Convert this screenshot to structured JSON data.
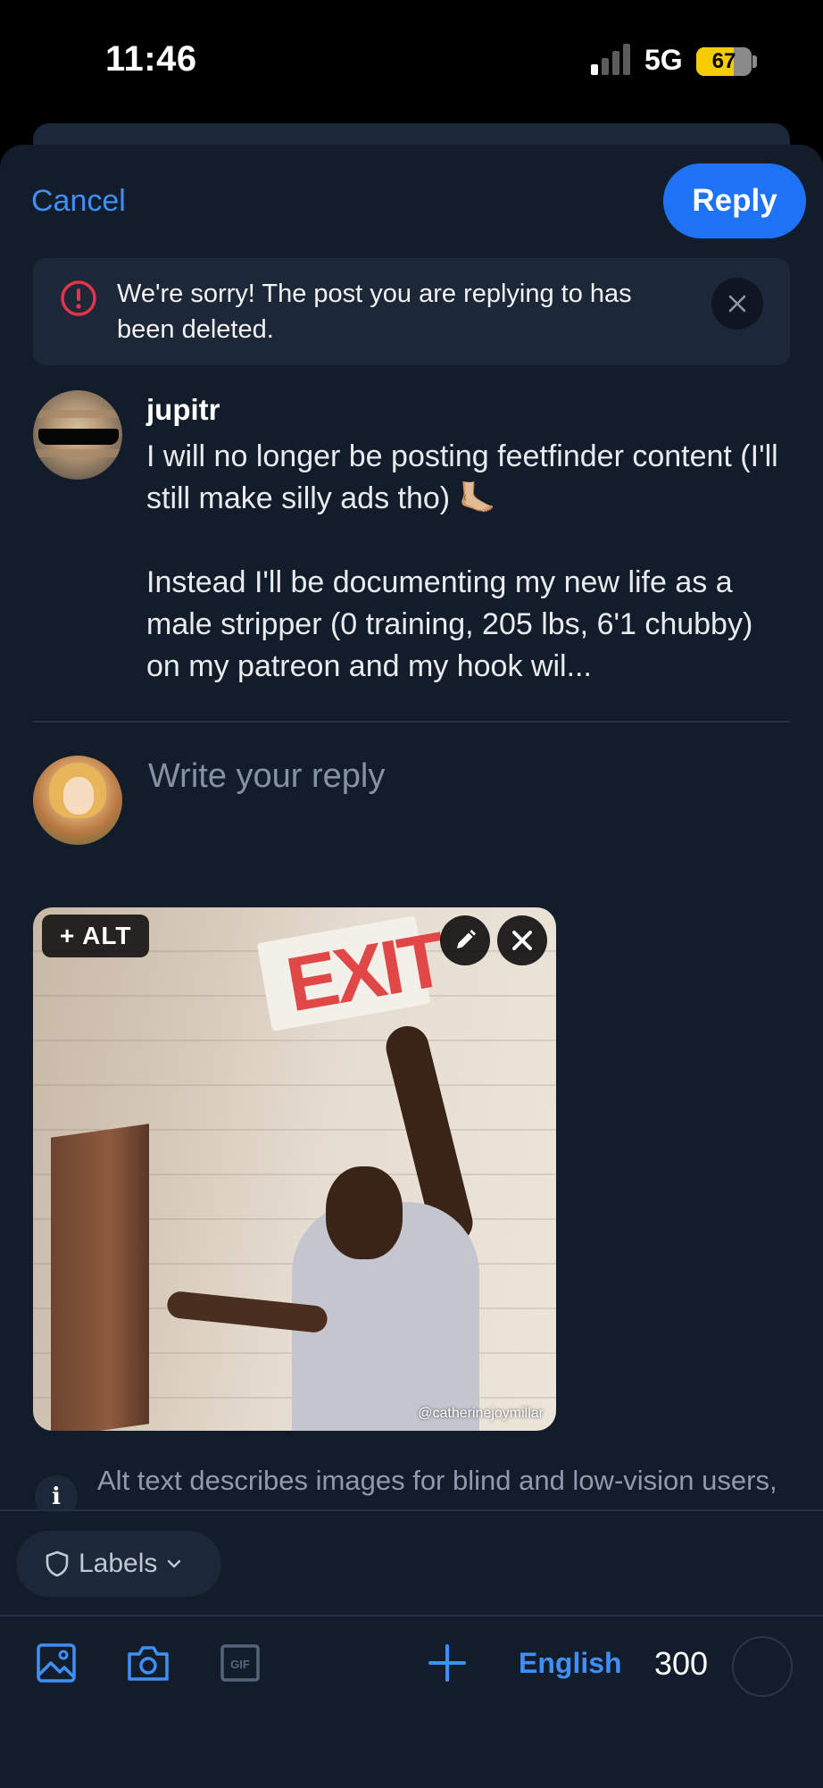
{
  "status_bar": {
    "time": "11:46",
    "network": "5G",
    "battery_level": "67",
    "signal_bars_active": 1,
    "signal_bars_total": 4
  },
  "header": {
    "cancel_label": "Cancel",
    "reply_label": "Reply",
    "accent_color": "#1e73f5"
  },
  "alert": {
    "message": "We're sorry! The post you are replying to has been deleted.",
    "icon": "alert-circle-icon",
    "icon_color": "#e5334b"
  },
  "quoted_post": {
    "author": "jupitr",
    "paragraph_1": "I will no longer be posting feetfinder content (I'll still make silly ads tho) 🦶🏼",
    "paragraph_2": "Instead I'll be documenting my new life as a male stripper (0 training, 205 lbs, 6'1 chubby) on my patreon and my hook wil..."
  },
  "composer": {
    "placeholder": "Write your reply",
    "attachment": {
      "alt_button_label": "+ ALT",
      "image_sign_text": "EXIT",
      "image_credit": "@catherinejoymillar"
    },
    "alt_info_text": "Alt text describes images for blind and low-vision users, and helps give context to everyone."
  },
  "toolbar": {
    "labels_label": "Labels",
    "language": "English",
    "char_remaining": "300",
    "icons": [
      "image-icon",
      "camera-icon",
      "gif-icon",
      "plus-icon"
    ]
  }
}
